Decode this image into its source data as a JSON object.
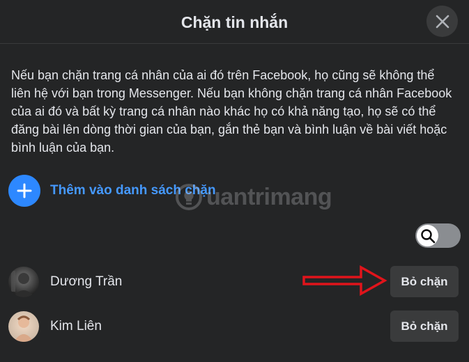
{
  "dialog": {
    "title": "Chặn tin nhắn",
    "close_icon": "close-icon",
    "description": "Nếu bạn chặn trang cá nhân của ai đó trên Facebook, họ cũng sẽ không thể liên hệ với bạn trong Messenger. Nếu bạn không chặn trang cá nhân Facebook của ai đó và bất kỳ trang cá nhân nào khác họ có khả năng tạo, họ sẽ có thể đăng bài lên dòng thời gian của bạn, gắn thẻ bạn và bình luận về bài viết hoặc bình luận của bạn.",
    "add_action": {
      "icon": "plus-icon",
      "label": "Thêm vào danh sách chặn"
    },
    "watermark": "uantrimang",
    "search_icon": "search-icon",
    "blocked": [
      {
        "name": "Dương Trần",
        "button": "Bỏ chặn"
      },
      {
        "name": "Kim Liên",
        "button": "Bỏ chặn"
      }
    ]
  },
  "colors": {
    "background": "#242526",
    "accent": "#2d88ff",
    "accent_text": "#4599ff",
    "button_bg": "#3a3b3c",
    "annotation_arrow": "#e0141b"
  }
}
